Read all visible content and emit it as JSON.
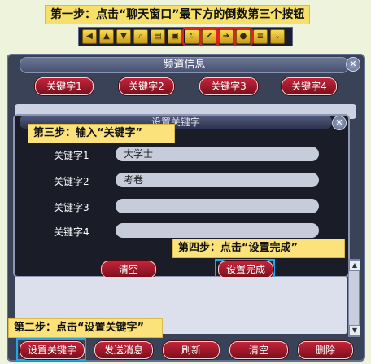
{
  "step1": "第一步：点击“聊天窗口”最下方的倒数第三个按钮",
  "step2": "第二步：点击“设置关键字”",
  "step3": "第三步：输入“关键字”",
  "step4": "第四步：点击“设置完成”",
  "toolbar": {
    "icons": [
      "arrow-left-icon",
      "arrow-up-icon",
      "arrow-down-icon",
      "magnifier-icon",
      "document-icon",
      "window-icon",
      "arrow-loop-icon",
      "check-icon",
      "arrow-right-icon",
      "speech-bubble-icon",
      "list-icon",
      "chevron-down-icon"
    ]
  },
  "channel_window": {
    "title": "频道信息",
    "keyword_tabs": [
      "关键字1",
      "关键字2",
      "关键字3",
      "关键字4"
    ],
    "close": "✕"
  },
  "set_dialog": {
    "title": "设置关键字",
    "labels": [
      "关键字1",
      "关键字2",
      "关键字3",
      "关键字4"
    ],
    "values": [
      "大学士",
      "考卷",
      "",
      ""
    ],
    "clear": "清空",
    "done": "设置完成",
    "close": "✕"
  },
  "bottom_buttons": [
    "设置关键字",
    "发送消息",
    "刷新",
    "清空",
    "删除"
  ]
}
